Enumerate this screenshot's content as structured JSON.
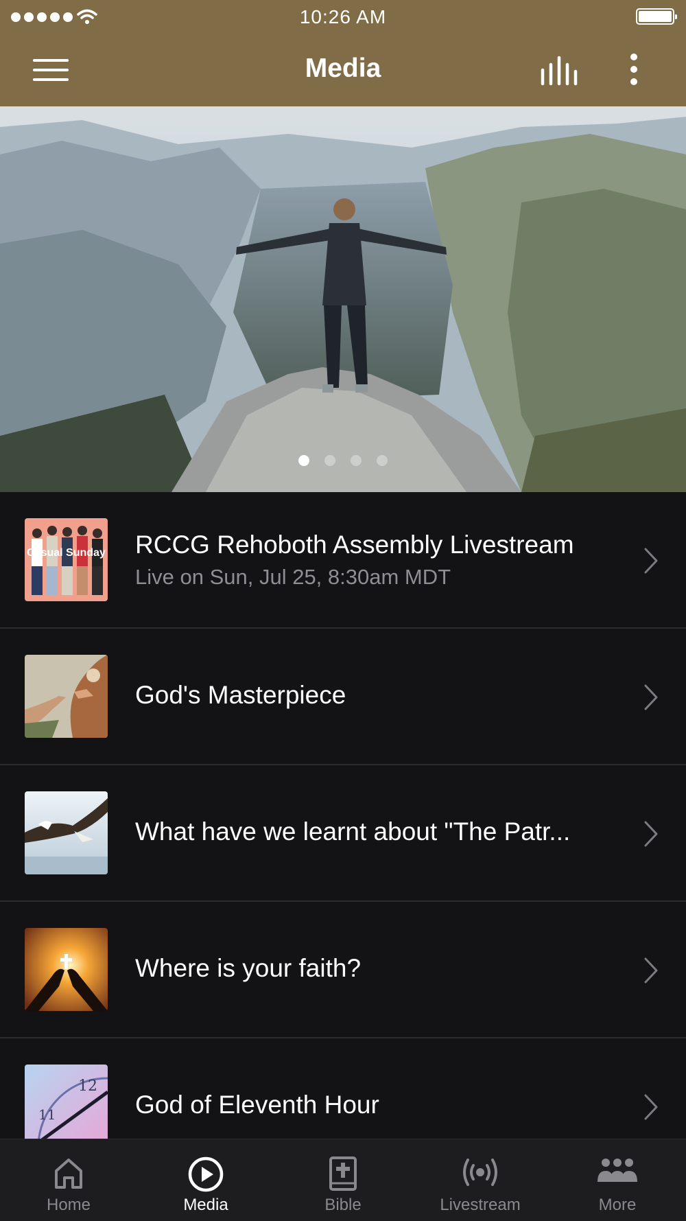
{
  "status_bar": {
    "time": "10:26 AM"
  },
  "header": {
    "title": "Media",
    "menu_icon": "hamburger-menu-icon",
    "audio_icon": "audio-bars-icon",
    "more_icon": "vertical-ellipsis-icon"
  },
  "hero": {
    "image": "person-on-mountain-cliff-arms-outstretched",
    "page_count": 4,
    "active_page": 1
  },
  "media_items": [
    {
      "title": "RCCG Rehoboth Assembly Livestream",
      "subtitle": "Live on Sun, Jul 25, 8:30am MDT",
      "thumb_text": "Casual Sunday",
      "thumb": "casual-sunday-people"
    },
    {
      "title": "God's Masterpiece",
      "thumb": "creation-of-adam-painting"
    },
    {
      "title": "What have we learnt about \"The Patr...",
      "thumb": "bald-eagle-flying"
    },
    {
      "title": "Where is your faith?",
      "thumb": "hands-holding-cross-sunset"
    },
    {
      "title": "God of Eleventh Hour",
      "thumb": "clock-face"
    }
  ],
  "tabs": [
    {
      "label": "Home",
      "icon": "home-icon",
      "active": false
    },
    {
      "label": "Media",
      "icon": "play-circle-icon",
      "active": true
    },
    {
      "label": "Bible",
      "icon": "bible-icon",
      "active": false
    },
    {
      "label": "Livestream",
      "icon": "broadcast-icon",
      "active": false
    },
    {
      "label": "More",
      "icon": "group-icon",
      "active": false
    }
  ],
  "colors": {
    "header": "#806d48",
    "list_background": "#131315",
    "tab_background": "#1d1d1f",
    "inactive_tab": "#8a8a8e"
  }
}
